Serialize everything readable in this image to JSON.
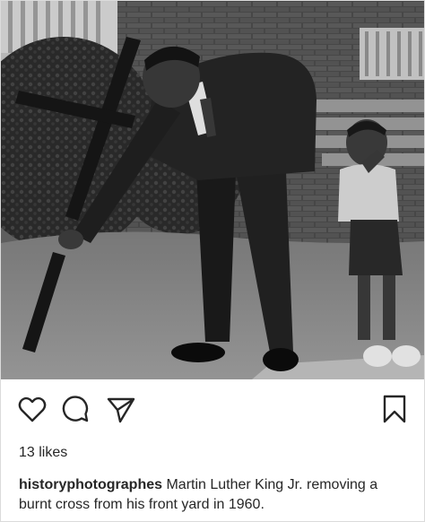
{
  "post": {
    "photo_alt": "",
    "likes_text": "13 likes",
    "caption": {
      "username": "historyphotographes",
      "text": "Martin Luther King Jr. removing a burnt cross from his front yard in 1960."
    }
  },
  "icons": {
    "like": "heart-icon",
    "comment": "comment-icon",
    "share": "share-icon",
    "save": "bookmark-icon"
  },
  "colors": {
    "text": "#262626",
    "border": "#dbdbdb",
    "background": "#ffffff"
  }
}
